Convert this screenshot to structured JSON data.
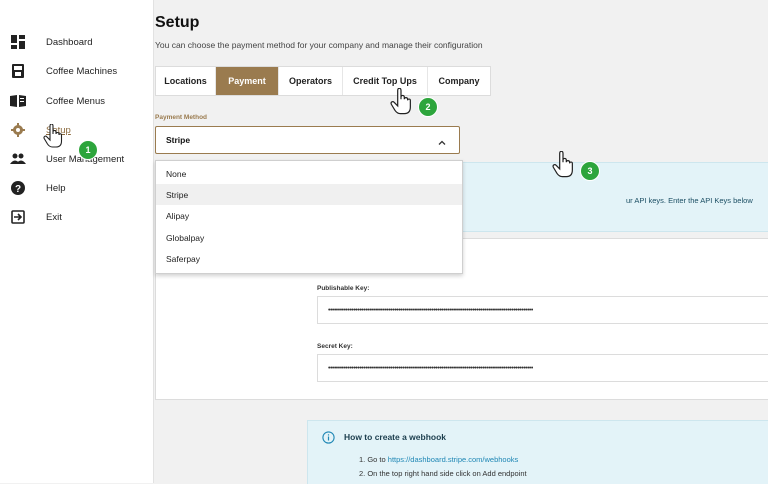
{
  "colors": {
    "accent": "#9a7b4f",
    "badge": "#2da53c",
    "info_bg": "#e3f3f8",
    "link": "#1f87b5"
  },
  "sidebar": {
    "items": [
      {
        "label": "Dashboard",
        "icon": "dashboard-icon"
      },
      {
        "label": "Coffee Machines",
        "icon": "coffee-machine-icon"
      },
      {
        "label": "Coffee Menus",
        "icon": "menu-book-icon"
      },
      {
        "label": "Setup",
        "icon": "gear-icon",
        "active": true
      },
      {
        "label": "User Management",
        "icon": "users-icon"
      },
      {
        "label": "Help",
        "icon": "help-icon"
      },
      {
        "label": "Exit",
        "icon": "exit-icon"
      }
    ]
  },
  "page": {
    "title": "Setup",
    "subtitle": "You can choose the payment method for your company and manage their configuration"
  },
  "tabs": [
    {
      "label": "Locations"
    },
    {
      "label": "Payment",
      "active": true
    },
    {
      "label": "Operators"
    },
    {
      "label": "Credit Top Ups"
    },
    {
      "label": "Company"
    }
  ],
  "payment_method": {
    "label": "Payment Method",
    "selected": "Stripe",
    "options": [
      "None",
      "Stripe",
      "Alipay",
      "Globalpay",
      "Saferpay"
    ]
  },
  "info": {
    "text": "ur API keys. Enter the API Keys below"
  },
  "keys": {
    "publishable_label": "Publishable Key:",
    "publishable_value": "•••••••••••••••••••••••••••••••••••••••••••••••••••••••••••••••••••••••••••••••••••••••••••••••••••••••••",
    "secret_label": "Secret Key:",
    "secret_value": "•••••••••••••••••••••••••••••••••••••••••••••••••••••••••••••••••••••••••••••••••••••••••••••••••••••••••"
  },
  "webhook": {
    "title": "How to create a webhook",
    "step1_prefix": "1. Go to ",
    "step1_link": "https://dashboard.stripe.com/webhooks",
    "step2": "2. On the top right hand side click on Add endpoint"
  },
  "annotations": {
    "badges": [
      "1",
      "2",
      "3"
    ]
  }
}
